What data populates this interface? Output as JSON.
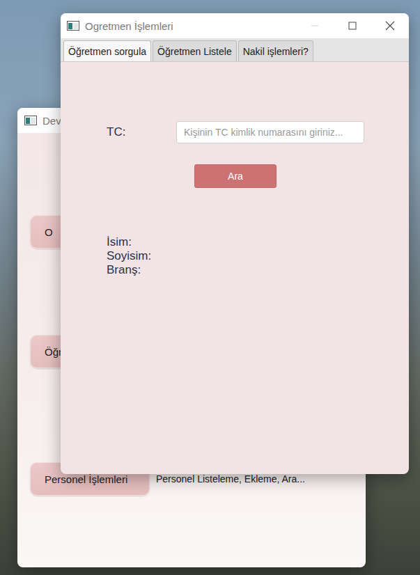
{
  "back_window": {
    "title": "Devi",
    "buttons": [
      {
        "label": "O"
      },
      {
        "label": "Öğr"
      },
      {
        "label": "Personel İşlemleri",
        "description": "Personel Listeleme, Ekleme, Ara..."
      }
    ]
  },
  "window": {
    "title": "Ogretmen İşlemleri"
  },
  "tabs": [
    {
      "label": "Öğretmen sorgula",
      "selected": true
    },
    {
      "label": "Öğretmen Listele",
      "selected": false
    },
    {
      "label": "Nakil işlemleri?",
      "selected": false
    }
  ],
  "form": {
    "tc_label": "TC:",
    "tc_placeholder": "Kişinin TC kimlik numarasını giriniz...",
    "search_button": "Ara",
    "fields": [
      "İsim:",
      "Soyisim:",
      "Branş:"
    ]
  }
}
